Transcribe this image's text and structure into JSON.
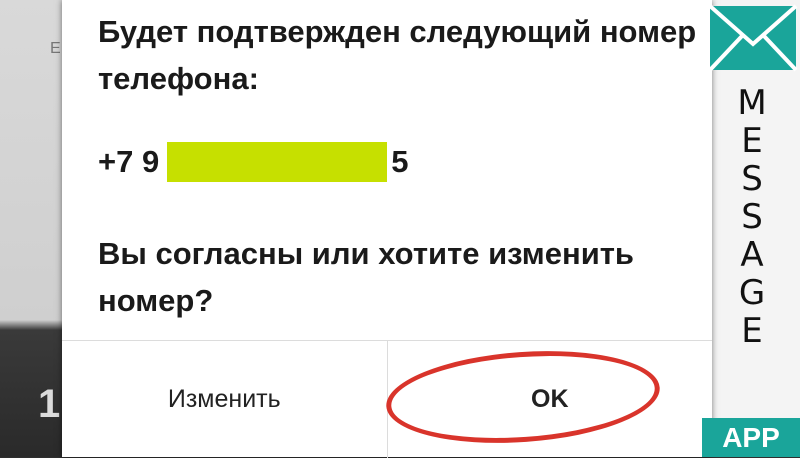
{
  "dialog": {
    "message": "Будет подтвержден следующий номер телефона:",
    "phone_prefix": "+7 9",
    "phone_suffix": "5",
    "question": "Вы согласны или хотите изменить номер?",
    "buttons": {
      "change_label": "Изменить",
      "ok_label": "OK"
    }
  },
  "background": {
    "left_digit": "1",
    "left_edge_letter": "E"
  },
  "logo": {
    "letters": [
      "M",
      "E",
      "S",
      "S",
      "A",
      "G",
      "E"
    ],
    "badge": "APP",
    "icon": "envelope-icon",
    "color": "#1aa59a"
  },
  "highlights": {
    "mask_color": "#c6e000",
    "circle_color": "#d9342b"
  }
}
